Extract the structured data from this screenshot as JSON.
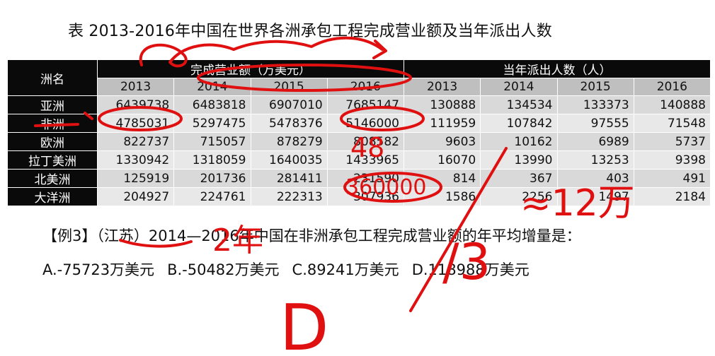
{
  "title": "表 2013-2016年中国在世界各洲承包工程完成营业额及当年派出人数",
  "table": {
    "col_name": "洲名",
    "group1": "完成营业额（万美元）",
    "group2": "当年派出人数（人）",
    "years": [
      "2013",
      "2014",
      "2015",
      "2016",
      "2013",
      "2014",
      "2015",
      "2016"
    ],
    "rows": [
      {
        "name": "亚洲",
        "values": [
          "6439738",
          "6483818",
          "6907010",
          "7685147",
          "130888",
          "134534",
          "133373",
          "140888"
        ]
      },
      {
        "name": "非洲",
        "values": [
          "4785031",
          "5297475",
          "5478376",
          "5146000",
          "111959",
          "107842",
          "97555",
          "71548"
        ]
      },
      {
        "name": "欧洲",
        "values": [
          "822737",
          "715057",
          "878279",
          "808582",
          "9603",
          "10162",
          "6989",
          "5737"
        ]
      },
      {
        "name": "拉丁美洲",
        "values": [
          "1330942",
          "1318059",
          "1640035",
          "1433965",
          "16070",
          "13990",
          "13253",
          "9398"
        ]
      },
      {
        "name": "北美洲",
        "values": [
          "125919",
          "201736",
          "281411",
          "231590",
          "814",
          "367",
          "403",
          "491"
        ]
      },
      {
        "name": "大洋洲",
        "values": [
          "204927",
          "224761",
          "222313",
          "307936",
          "1586",
          "2256",
          "1497",
          "2184"
        ]
      }
    ]
  },
  "example": {
    "label": "【例3】",
    "source": "（江苏）",
    "question": "2014—2016年中国在非洲承包工程完成营业额的年平均增量是："
  },
  "options": [
    "A.-75723万美元",
    "B.-50482万美元",
    "C.89241万美元",
    "D.118988万美元"
  ],
  "annotations": {
    "note_48": "48",
    "note_360000": "360000",
    "note_2nian": "2年",
    "note_frac": "/3",
    "note_approx": "≈12万",
    "note_answer": "D"
  },
  "colors": {
    "header_bg": "#0a0a0a",
    "year_bg": "#bfbfbf",
    "cell_bg": "#d9d9d9",
    "ink": "#e01010"
  }
}
